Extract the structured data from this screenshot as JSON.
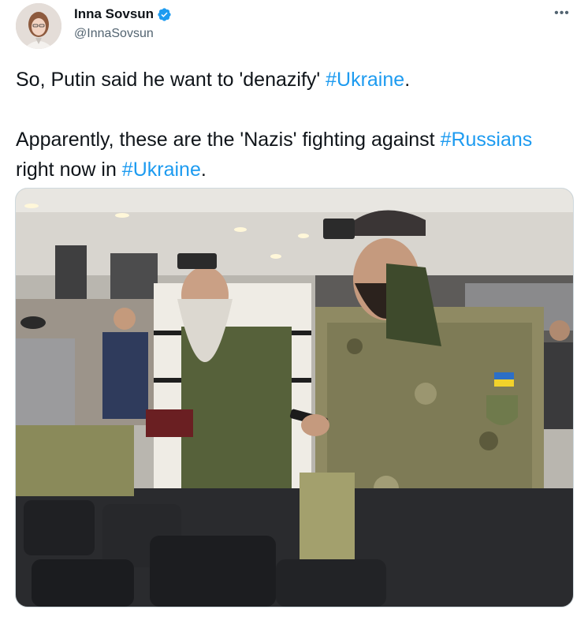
{
  "author": {
    "display_name": "Inna Sovsun",
    "handle": "@InnaSovsun",
    "verified": true,
    "avatar_icon": "profile-photo"
  },
  "menu": {
    "more_label": "•••"
  },
  "tweet": {
    "line1_text": "So, Putin said he want to 'denazify' ",
    "line1_hashtag": "#Ukraine",
    "line1_end": ".",
    "line2_text": "Apparently, these are the 'Nazis' fighting against ",
    "line2_hashtag1": "#Russians",
    "line2_mid": " right now in ",
    "line2_hashtag2": "#Ukraine",
    "line2_end": "."
  },
  "photo": {
    "description_icon": "attached-photo",
    "flag_colors": [
      "#2c6fc7",
      "#f2d22b"
    ]
  },
  "colors": {
    "accent": "#1d9bf0",
    "text": "#0f1419",
    "muted": "#536471"
  }
}
